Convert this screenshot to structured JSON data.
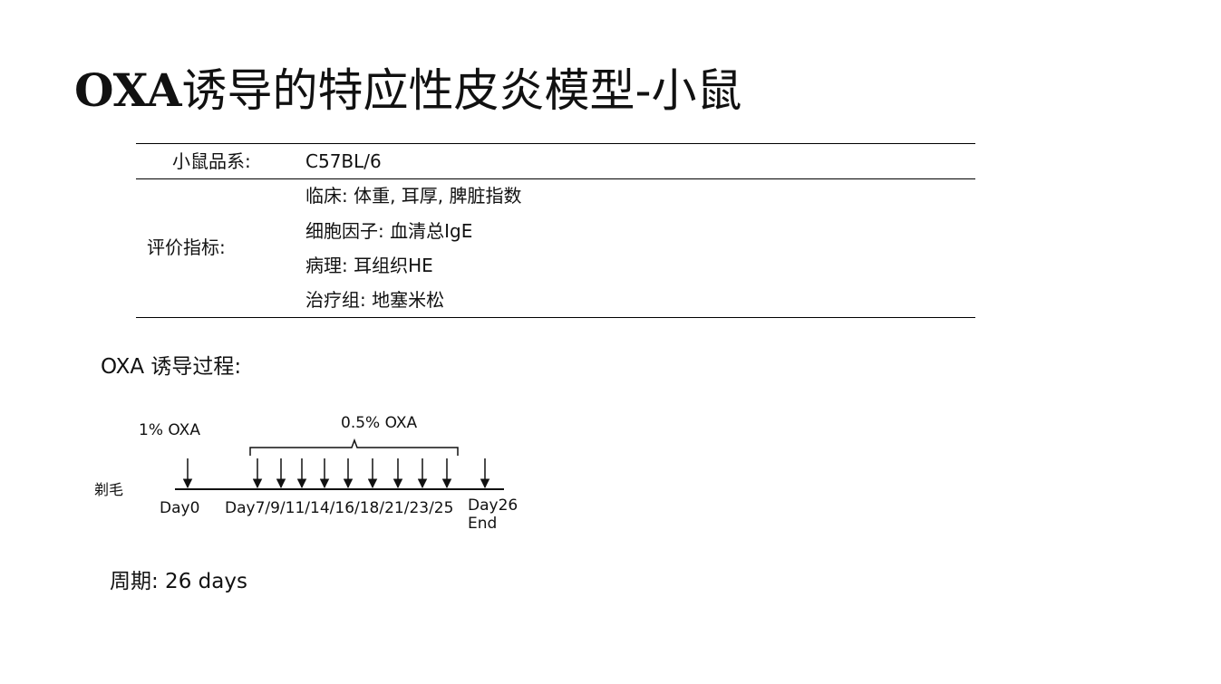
{
  "title": {
    "prefix": "OXA",
    "suffix": "诱导的特应性皮炎模型-小鼠"
  },
  "info_table": {
    "strain_label": "小鼠品系:",
    "strain_value": "C57BL/6",
    "metrics_label": "评价指标:",
    "metrics": [
      "临床: 体重, 耳厚, 脾脏指数",
      "细胞因子: 血清总IgE",
      "病理:  耳组织HE",
      "治疗组: 地塞米松"
    ]
  },
  "induction": {
    "heading": "OXA 诱导过程:",
    "shave_label": "剃毛",
    "initial_dose": "1% OXA",
    "repeat_dose": "0.5% OXA",
    "day0_label": "Day0",
    "repeat_days_label": "Day7/9/11/14/16/18/21/23/25",
    "end_day_label": "Day26",
    "end_label": "End",
    "days": [
      0,
      7,
      9,
      11,
      14,
      16,
      18,
      21,
      23,
      25,
      26
    ]
  },
  "cycle": "周期: 26 days"
}
